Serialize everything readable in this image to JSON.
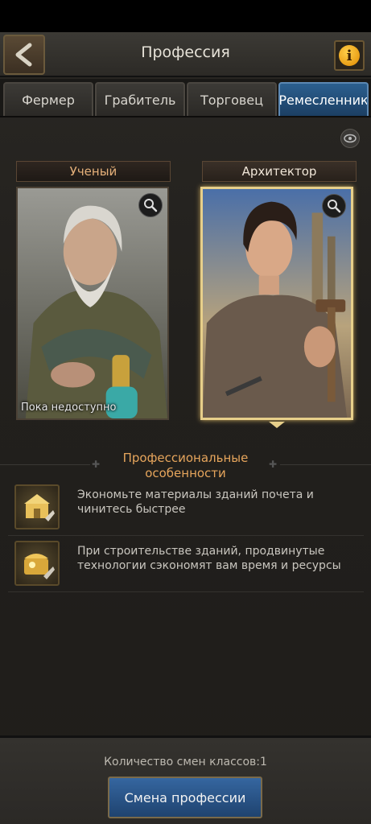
{
  "header": {
    "title": "Профессия",
    "back_icon": "back-arrow-icon",
    "info_icon": "info-icon"
  },
  "tabs": [
    {
      "label": "Фермер",
      "active": false
    },
    {
      "label": "Грабитель",
      "active": false
    },
    {
      "label": "Торговец",
      "active": false
    },
    {
      "label": "Ремесленник",
      "active": true
    }
  ],
  "cards": [
    {
      "label": "Ученый",
      "status": "Пока недоступно",
      "selected": false
    },
    {
      "label": "Архитектор",
      "status": "",
      "selected": true
    }
  ],
  "features": {
    "title": "Профессиональные особенности",
    "items": [
      {
        "text": "Экономьте материалы зданий почета и чинитесь быстрее"
      },
      {
        "text": "При строительстве зданий, продвинутые технологии сэкономят вам время и ресурсы"
      }
    ]
  },
  "bottom": {
    "change_count": "Количество смен классов:1",
    "change_button": "Смена профессии"
  },
  "colors": {
    "accent_gold": "#e7cf8a",
    "tab_active": "#2b5f8f",
    "feature_title": "#e6a55c"
  }
}
